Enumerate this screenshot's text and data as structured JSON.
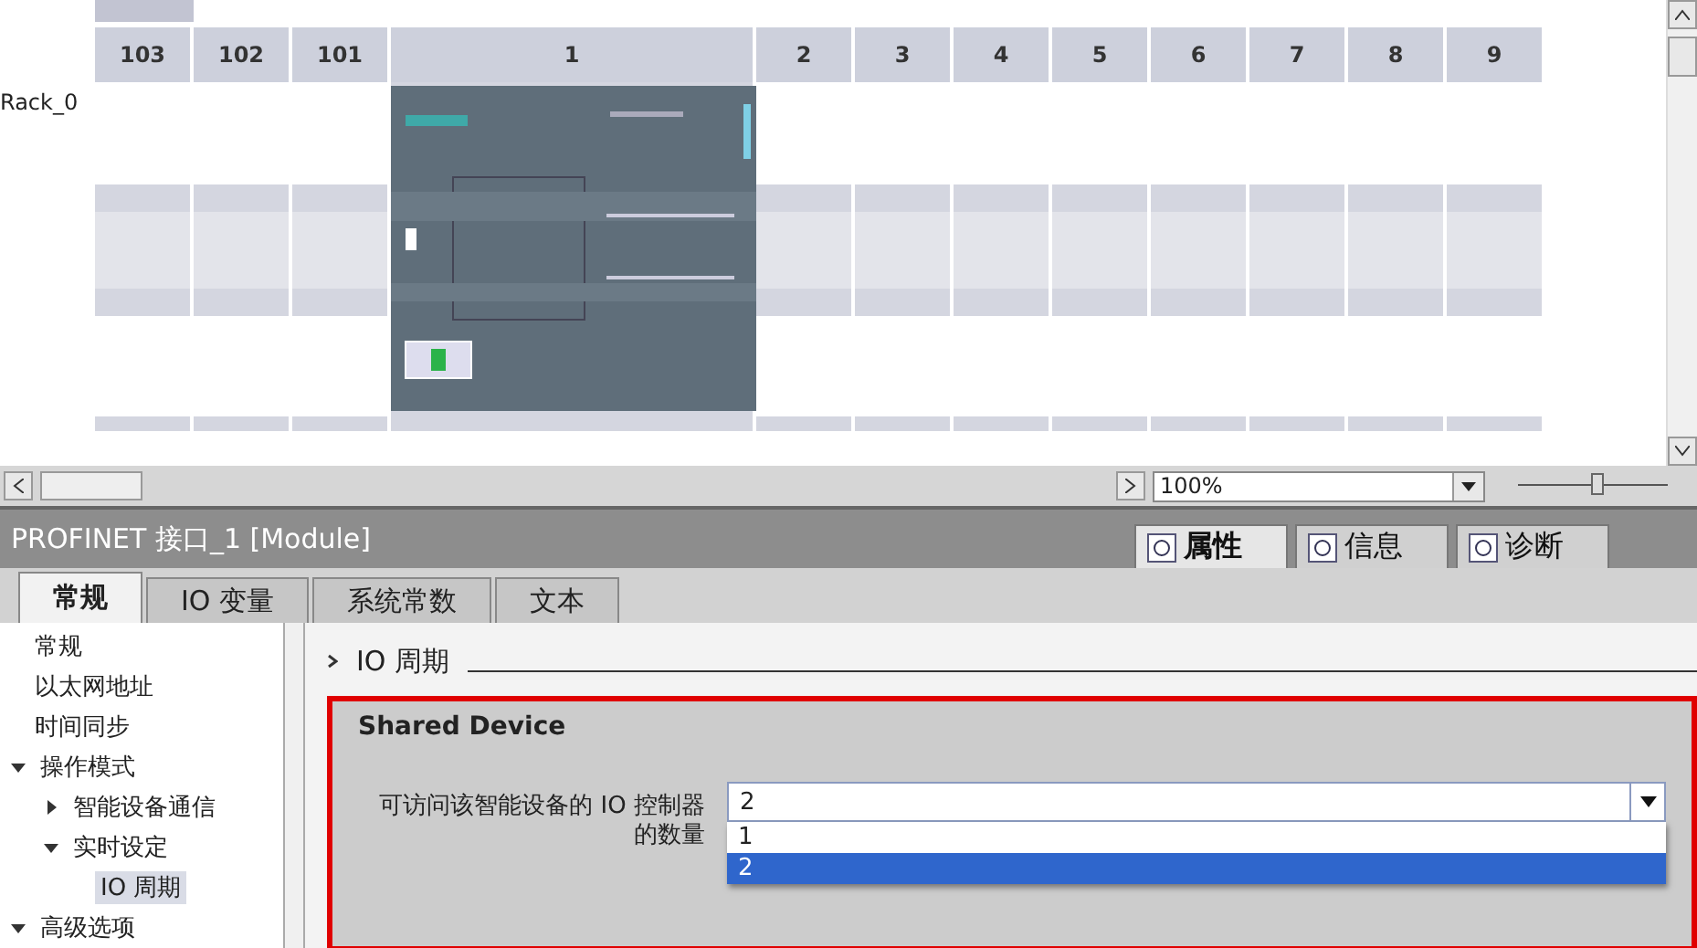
{
  "rack": {
    "name": "Rack_0",
    "slots": [
      {
        "label": "103",
        "kind": "empty"
      },
      {
        "label": "102",
        "kind": "empty"
      },
      {
        "label": "101",
        "kind": "empty"
      },
      {
        "label": "1",
        "kind": "cpu"
      },
      {
        "label": "2",
        "kind": "empty"
      },
      {
        "label": "3",
        "kind": "empty"
      },
      {
        "label": "4",
        "kind": "empty"
      },
      {
        "label": "5",
        "kind": "empty"
      },
      {
        "label": "6",
        "kind": "empty"
      },
      {
        "label": "7",
        "kind": "empty"
      },
      {
        "label": "8",
        "kind": "empty"
      },
      {
        "label": "9",
        "kind": "empty"
      }
    ]
  },
  "zoom": {
    "value": "100%",
    "level": 0.53
  },
  "inspector": {
    "title": "PROFINET 接口_1 [Module]",
    "view_tabs": [
      {
        "label": "属性",
        "selected": true
      },
      {
        "label": "信息",
        "selected": false
      },
      {
        "label": "诊断",
        "selected": false
      }
    ],
    "tabs": [
      {
        "label": "常规",
        "selected": true
      },
      {
        "label": "IO 变量",
        "selected": false
      },
      {
        "label": "系统常数",
        "selected": false
      },
      {
        "label": "文本",
        "selected": false
      }
    ],
    "nav": [
      {
        "label": "常规",
        "selected": false
      },
      {
        "label": "以太网地址",
        "selected": false
      },
      {
        "label": "时间同步",
        "selected": false
      },
      {
        "label": "操作模式",
        "selected": false,
        "expanded": true,
        "children": [
          {
            "label": "智能设备通信",
            "selected": false,
            "expanded": false
          },
          {
            "label": "实时设定",
            "selected": false,
            "expanded": true,
            "children": [
              {
                "label": "IO 周期",
                "selected": true
              }
            ]
          }
        ]
      },
      {
        "label": "高级选项",
        "selected": false,
        "expanded": true
      }
    ],
    "section": {
      "title": "IO 周期",
      "highlighted": true,
      "group": {
        "title": "Shared Device",
        "field_label": "可访问该智能设备的 IO 控制器的数量",
        "value": "2",
        "open": true,
        "options": [
          {
            "label": "1",
            "selected": false
          },
          {
            "label": "2",
            "selected": true
          }
        ]
      }
    }
  }
}
